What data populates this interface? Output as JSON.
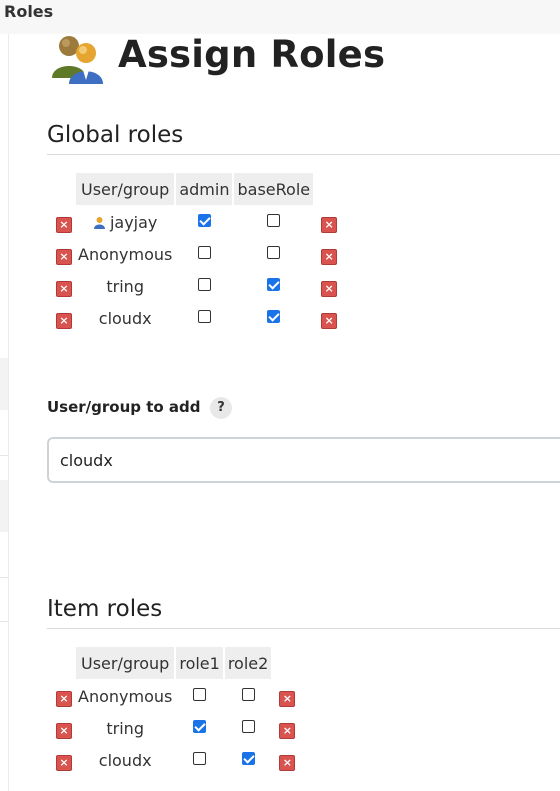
{
  "breadcrumb": {
    "current": "Roles"
  },
  "page": {
    "title": "Assign Roles",
    "icon": "users-group-icon"
  },
  "global_roles": {
    "heading": "Global roles",
    "header": [
      "User/group",
      "admin",
      "baseRole"
    ],
    "rows": [
      {
        "name": "jayjay",
        "user_icon": true,
        "checks": [
          true,
          false
        ]
      },
      {
        "name": "Anonymous",
        "user_icon": false,
        "checks": [
          false,
          false
        ]
      },
      {
        "name": "tring",
        "user_icon": false,
        "checks": [
          false,
          true
        ]
      },
      {
        "name": "cloudx",
        "user_icon": false,
        "checks": [
          false,
          true
        ]
      }
    ]
  },
  "add_user": {
    "label": "User/group to add",
    "help": "?",
    "value": "cloudx"
  },
  "item_roles": {
    "heading": "Item roles",
    "header": [
      "User/group",
      "role1",
      "role2"
    ],
    "rows": [
      {
        "name": "Anonymous",
        "user_icon": false,
        "checks": [
          false,
          false
        ]
      },
      {
        "name": "tring",
        "user_icon": false,
        "checks": [
          true,
          false
        ]
      },
      {
        "name": "cloudx",
        "user_icon": false,
        "checks": [
          false,
          true
        ]
      }
    ]
  },
  "icons": {
    "delete": "delete-icon",
    "user": "user-icon"
  },
  "colors": {
    "checkbox_checked": "#1a73e8",
    "delete_icon": "#d9534f"
  }
}
